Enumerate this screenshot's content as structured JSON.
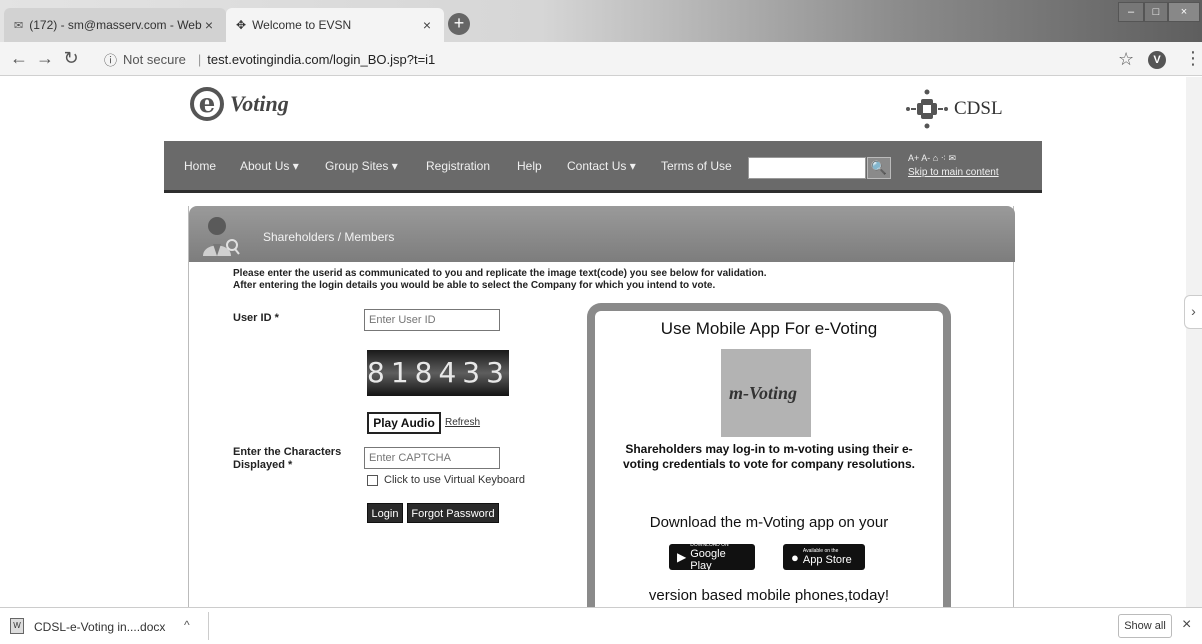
{
  "browser": {
    "tabs": [
      {
        "label": "(172) - sm@masserv.com - Webr",
        "icon": "mail-icon"
      },
      {
        "label": "Welcome to EVSN",
        "icon": "evsn-icon"
      }
    ],
    "close_glyph": "×",
    "new_tab_glyph": "+",
    "security_label": "Not secure",
    "url": "test.evotingindia.com/login_BO.jsp?t=i1",
    "profile_initial": "V",
    "window_controls": {
      "min": "–",
      "max": "□",
      "close": "×"
    }
  },
  "site": {
    "logo_text": "Voting",
    "logo_letter": "e",
    "partner_logo_text": "CDSL",
    "nav": [
      "Home",
      "About Us ▾",
      "Group Sites ▾",
      "Registration",
      "Help",
      "Contact Us ▾",
      "Terms of Use"
    ],
    "search_placeholder": "",
    "search_button_glyph": "🔍",
    "tools_text": "A+  A-  ⌂  ⁖  ✉",
    "skip_link": "Skip to main content"
  },
  "panel": {
    "title": "Shareholders / Members",
    "instruction_line1": "Please enter the userid as communicated to you and replicate the image text(code) you see below for validation.",
    "instruction_line2": "After entering the login details you would be able to select the Company for which you intend to vote.",
    "user_id_label": "User ID *",
    "user_id_placeholder": "Enter User ID",
    "captcha_code": "818433",
    "play_audio": "Play Audio",
    "refresh": "Refresh",
    "captcha_label_line1": "Enter the Characters",
    "captcha_label_line2": "Displayed *",
    "captcha_placeholder": "Enter CAPTCHA",
    "virtual_keyboard": "Click to use Virtual Keyboard",
    "login_button": "Login",
    "forgot_button": "Forgot Password"
  },
  "mobile_box": {
    "title": "Use Mobile App For e-Voting",
    "logo_text": "m-Voting",
    "description": "Shareholders may log-in to m-voting using their e-voting credentials to vote for company resolutions.",
    "download_text": "Download the m-Voting app on your",
    "google_play_small": "DOWNLOAD ON",
    "google_play": "Google Play",
    "app_store_small": "Available on the",
    "app_store": "App Store",
    "footer_text": "version based mobile phones,today!"
  },
  "downloads": {
    "file_name": "CDSL-e-Voting in....docx",
    "show_all": "Show all",
    "close_glyph": "×",
    "caret_glyph": "^"
  }
}
